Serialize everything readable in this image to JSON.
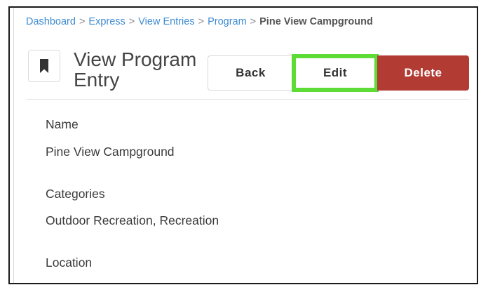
{
  "breadcrumb": {
    "items": [
      "Dashboard",
      "Express",
      "View Entries",
      "Program"
    ],
    "separator": ">",
    "current": "Pine View Campground"
  },
  "header": {
    "icon": "bookmark-icon",
    "title": "View Program Entry"
  },
  "toolbar": {
    "back_label": "Back",
    "edit_label": "Edit",
    "delete_label": "Delete"
  },
  "colors": {
    "link": "#3f8bd1",
    "delete": "#b23b34",
    "highlight": "#5cdc35"
  },
  "fields": [
    {
      "label": "Name",
      "value": "Pine View Campground"
    },
    {
      "label": "Categories",
      "value": "Outdoor Recreation, Recreation"
    },
    {
      "label": "Location"
    }
  ]
}
